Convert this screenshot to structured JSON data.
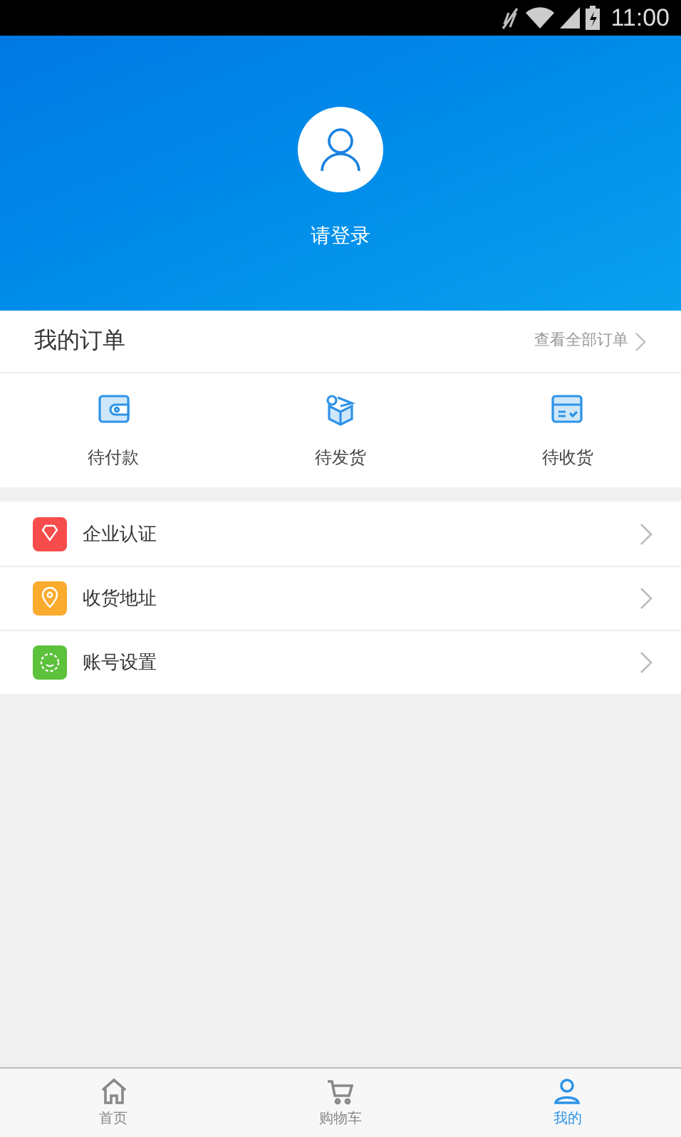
{
  "status_bar": {
    "time": "11:00"
  },
  "profile": {
    "login_label": "请登录"
  },
  "orders": {
    "title": "我的订单",
    "view_all": "查看全部订单",
    "items": [
      {
        "kind": "wallet",
        "label": "待付款"
      },
      {
        "kind": "box",
        "label": "待发货"
      },
      {
        "kind": "tray",
        "label": "待收货"
      }
    ]
  },
  "menu": [
    {
      "kind": "diamond",
      "color": "#f74c4c",
      "label": "企业认证"
    },
    {
      "kind": "pin",
      "color": "#fbab2e",
      "label": "收货地址"
    },
    {
      "kind": "smile",
      "color": "#5cc13b",
      "label": "账号设置"
    }
  ],
  "tabs": [
    {
      "kind": "home",
      "label": "首页",
      "selected": false
    },
    {
      "kind": "cart",
      "label": "购物车",
      "selected": false
    },
    {
      "kind": "user",
      "label": "我的",
      "selected": true
    }
  ]
}
